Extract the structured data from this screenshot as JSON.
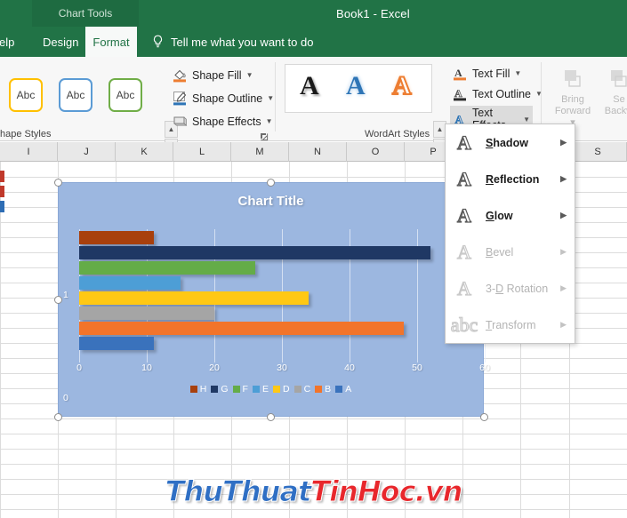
{
  "titlebar": {
    "chart_tools": "Chart Tools",
    "document_title": "Book1  -  Excel"
  },
  "tabs": [
    {
      "label": "elp",
      "name": "tab-help"
    },
    {
      "label": "Design",
      "name": "tab-design"
    },
    {
      "label": "Format",
      "name": "tab-format"
    }
  ],
  "tellme": {
    "label": "Tell me what you want to do",
    "icon": "lightbulb-icon"
  },
  "ribbon": {
    "shape_styles": {
      "group_label": "hape Styles",
      "thumbs": [
        "Abc",
        "Abc",
        "Abc"
      ],
      "buttons": [
        {
          "label": "Shape Fill",
          "icon": "paint-bucket-icon",
          "accent": "#ed7d31"
        },
        {
          "label": "Shape Outline",
          "icon": "pencil-outline-icon",
          "accent": "#2e75b6"
        },
        {
          "label": "Shape Effects",
          "icon": "shape-effects-icon",
          "accent": "#808080"
        }
      ],
      "spinners": [
        "▲",
        "▼",
        "▼"
      ]
    },
    "wordart_styles": {
      "group_label": "WordArt Styles",
      "thumbs": [
        "A",
        "A",
        "A"
      ],
      "buttons": [
        {
          "label": "Text Fill",
          "icon": "text-fill-icon",
          "accent": "#ed7d31"
        },
        {
          "label": "Text Outline",
          "icon": "text-outline-icon",
          "accent": "#2e75b6"
        },
        {
          "label": "Text Effects",
          "icon": "text-effects-icon",
          "accent": "#2e75b6"
        }
      ]
    },
    "arrange": [
      {
        "line1": "Bring",
        "line2": "Forward ▾",
        "icon": "bring-forward-icon"
      },
      {
        "line1": "Se",
        "line2": "Backw",
        "icon": "send-backward-icon"
      }
    ]
  },
  "text_effects_menu": {
    "items": [
      {
        "label_pre": "",
        "label_key": "S",
        "label_post": "hadow",
        "glyph": "A",
        "enabled": true,
        "name": "menu-item-shadow"
      },
      {
        "label_pre": "",
        "label_key": "R",
        "label_post": "eflection",
        "glyph": "A",
        "enabled": true,
        "name": "menu-item-reflection"
      },
      {
        "label_pre": "",
        "label_key": "G",
        "label_post": "low",
        "glyph": "A",
        "enabled": true,
        "name": "menu-item-glow"
      },
      {
        "label_pre": "",
        "label_key": "B",
        "label_post": "evel",
        "glyph": "A",
        "enabled": false,
        "name": "menu-item-bevel"
      },
      {
        "label_pre": "3-",
        "label_key": "D",
        "label_post": " Rotation",
        "glyph": "A",
        "enabled": false,
        "name": "menu-item-3d-rotation"
      },
      {
        "label_pre": "",
        "label_key": "T",
        "label_post": "ransform",
        "glyph": "abc",
        "enabled": false,
        "name": "menu-item-transform"
      }
    ],
    "submenu_arrow": "▶"
  },
  "sheet": {
    "column_headers": [
      "I",
      "J",
      "K",
      "L",
      "M",
      "N",
      "O",
      "P",
      "S"
    ]
  },
  "chart_data": {
    "type": "bar",
    "title": "Chart Title",
    "xlabel": "",
    "ylabel": "",
    "xlim": [
      0,
      60
    ],
    "xticks": [
      0,
      10,
      20,
      30,
      40,
      50,
      60
    ],
    "category_axis_labels": [
      "1",
      "0"
    ],
    "grid": true,
    "legend_position": "bottom",
    "categories": [
      "1"
    ],
    "legend": [
      "H",
      "G",
      "F",
      "E",
      "D",
      "C",
      "B",
      "A"
    ],
    "series": [
      {
        "name": "H",
        "color": "#a8400d",
        "values": [
          11
        ]
      },
      {
        "name": "G",
        "color": "#1f3864",
        "values": [
          52
        ]
      },
      {
        "name": "F",
        "color": "#64ac48",
        "values": [
          26
        ]
      },
      {
        "name": "E",
        "color": "#4d9ed6",
        "values": [
          15
        ]
      },
      {
        "name": "D",
        "color": "#ffc814",
        "values": [
          34
        ]
      },
      {
        "name": "C",
        "color": "#a5a5a5",
        "values": [
          20
        ]
      },
      {
        "name": "B",
        "color": "#f2742a",
        "values": [
          48
        ]
      },
      {
        "name": "A",
        "color": "#3a72bc",
        "values": [
          11
        ]
      }
    ],
    "plot_area_color": "#9cb7e0",
    "title_color": "#ffffff"
  },
  "watermark": {
    "part1": "ThuThuat",
    "part2": "TinHoc.vn",
    "color1": "#2f6fc4",
    "color2": "#e8272c"
  }
}
